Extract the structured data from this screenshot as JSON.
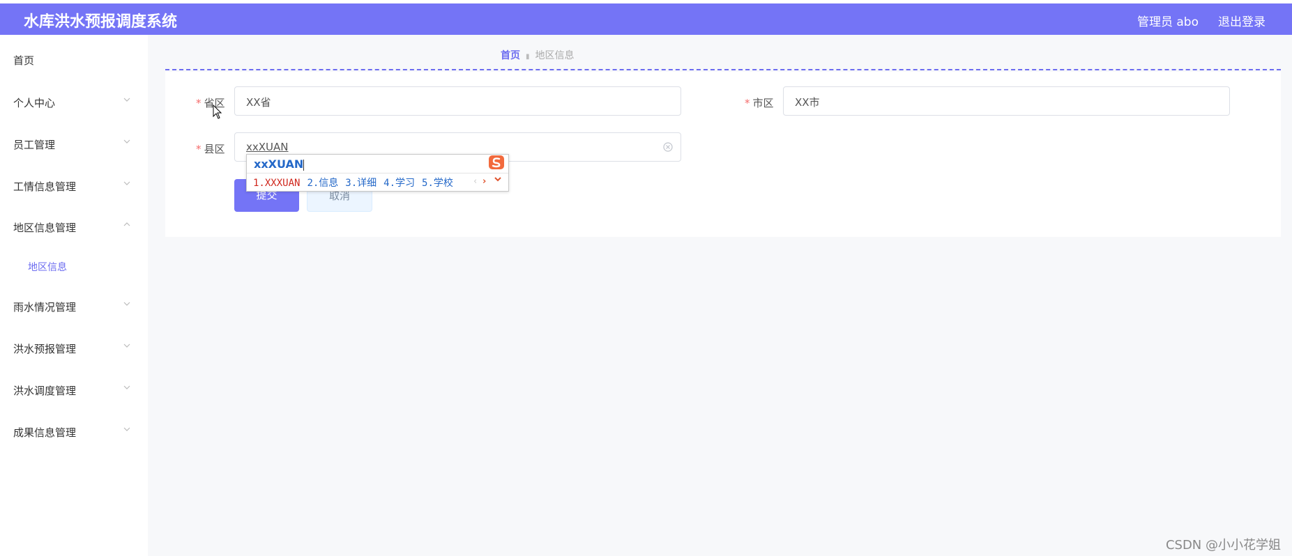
{
  "header": {
    "title": "水库洪水预报调度系统",
    "user": "管理员 abo",
    "logout": "退出登录"
  },
  "sidebar": {
    "items": [
      {
        "label": "首页"
      },
      {
        "label": "个人中心"
      },
      {
        "label": "员工管理"
      },
      {
        "label": "工情信息管理"
      },
      {
        "label": "地区信息管理"
      },
      {
        "label": "地区信息"
      },
      {
        "label": "雨水情况管理"
      },
      {
        "label": "洪水预报管理"
      },
      {
        "label": "洪水调度管理"
      },
      {
        "label": "成果信息管理"
      }
    ]
  },
  "breadcrumb": {
    "home": "首页",
    "current": "地区信息"
  },
  "form": {
    "required_mark": "*",
    "province": {
      "label": "省区",
      "value": "XX省"
    },
    "city": {
      "label": "市区",
      "value": "XX市"
    },
    "county": {
      "label": "县区",
      "value": "xxXUAN"
    },
    "submit": "提交",
    "cancel": "取消"
  },
  "ime": {
    "composition": "xxXUAN",
    "candidates": [
      "1.XXXUAN",
      "2.信息",
      "3.详细",
      "4.学习",
      "5.学校"
    ]
  },
  "watermark": "CSDN @小小花学姐",
  "colors": {
    "accent": "#7474f6",
    "required": "#f56c6c",
    "ime_blue": "#2468c8",
    "ime_red": "#d0281e"
  }
}
